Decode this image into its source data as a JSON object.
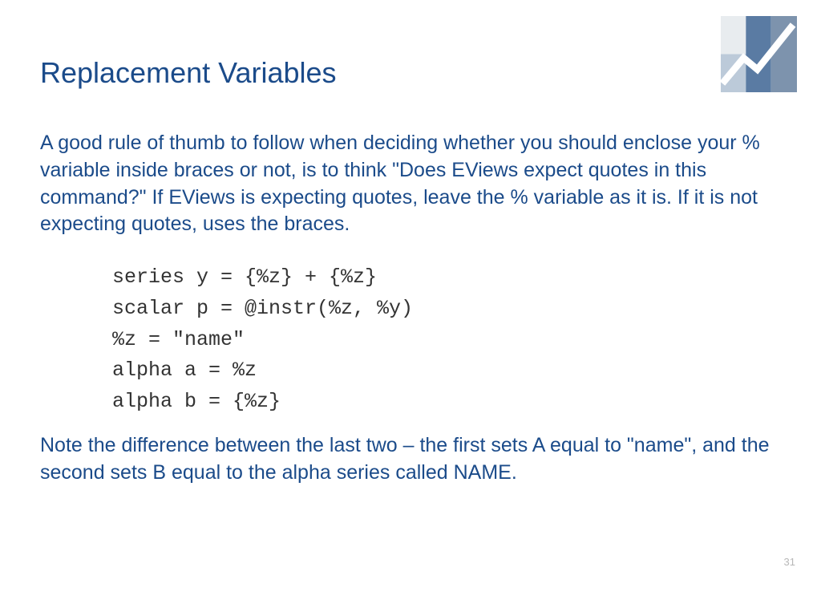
{
  "title": "Replacement Variables",
  "paragraph1": "A good rule of thumb to follow when deciding whether you should enclose your % variable inside braces or not, is to think \"Does EViews expect quotes in this command?\" If EViews is expecting quotes, leave the % variable as it is.  If it is not expecting quotes, uses the braces.",
  "code": {
    "line1": "series y = {%z} + {%z}",
    "line2": "scalar p = @instr(%z, %y)",
    "line3": "%z = \"name\"",
    "line4": "alpha a = %z",
    "line5": "alpha b = {%z}"
  },
  "paragraph2": "Note the difference between the last two – the first sets A equal to \"name\", and the second sets B equal to the alpha series called NAME.",
  "page_number": "31"
}
